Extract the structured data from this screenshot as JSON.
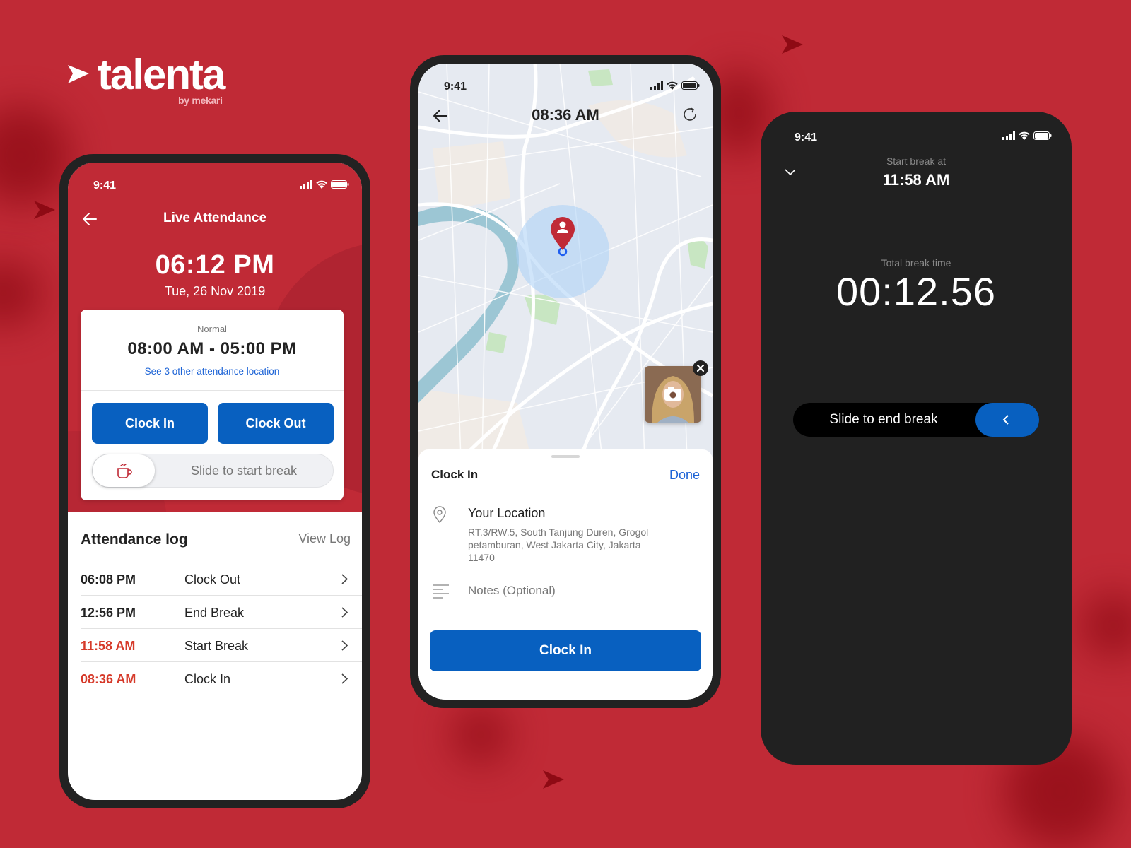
{
  "brand": {
    "name": "talenta",
    "byline": "by mekari",
    "colors": {
      "primary_red": "#c02a36",
      "primary_blue": "#0860c0",
      "link_blue": "#1c63d6",
      "late_red": "#d63a2a",
      "dark_bg": "#212121"
    }
  },
  "live_attendance_screen": {
    "status_bar": {
      "time": "9:41"
    },
    "nav": {
      "title": "Live Attendance",
      "back_icon": "arrow-left-icon"
    },
    "current_time": "06:12 PM",
    "current_date": "Tue, 26 Nov 2019",
    "shift_card": {
      "shift_type": "Normal",
      "shift_hours": "08:00 AM - 05:00 PM",
      "locations_link": "See 3 other attendance location",
      "clock_in_label": "Clock In",
      "clock_out_label": "Clock Out",
      "break_slider_label": "Slide to start break",
      "break_slider_icon": "coffee-cup-icon"
    },
    "log": {
      "title": "Attendance log",
      "view_log_label": "View Log",
      "rows": [
        {
          "time": "06:08 PM",
          "action": "Clock Out",
          "late": false
        },
        {
          "time": "12:56 PM",
          "action": "End Break",
          "late": false
        },
        {
          "time": "11:58 AM",
          "action": "Start Break",
          "late": true
        },
        {
          "time": "08:36 AM",
          "action": "Clock In",
          "late": true
        }
      ]
    }
  },
  "clock_in_screen": {
    "status_bar": {
      "time": "9:41"
    },
    "header_time": "08:36 AM",
    "back_icon": "arrow-left-icon",
    "refresh_icon": "refresh-icon",
    "map": {
      "marker_icon": "user-location-pin-icon"
    },
    "selfie": {
      "camera_icon": "camera-icon",
      "close_icon": "close-icon"
    },
    "sheet": {
      "title": "Clock In",
      "done_label": "Done",
      "location_title": "Your Location",
      "location_address": "RT.3/RW.5, South Tanjung Duren, Grogol petamburan, West Jakarta City, Jakarta 11470",
      "notes_placeholder": "Notes (Optional)",
      "notes_value": "",
      "submit_label": "Clock In"
    }
  },
  "break_screen": {
    "status_bar": {
      "time": "9:41"
    },
    "start_label": "Start break at",
    "start_time": "11:58 AM",
    "total_label": "Total break time",
    "total_value": "00:12.56",
    "slider_label": "Slide to end break",
    "collapse_icon": "chevron-down-icon",
    "slider_icon": "chevron-left-icon"
  }
}
